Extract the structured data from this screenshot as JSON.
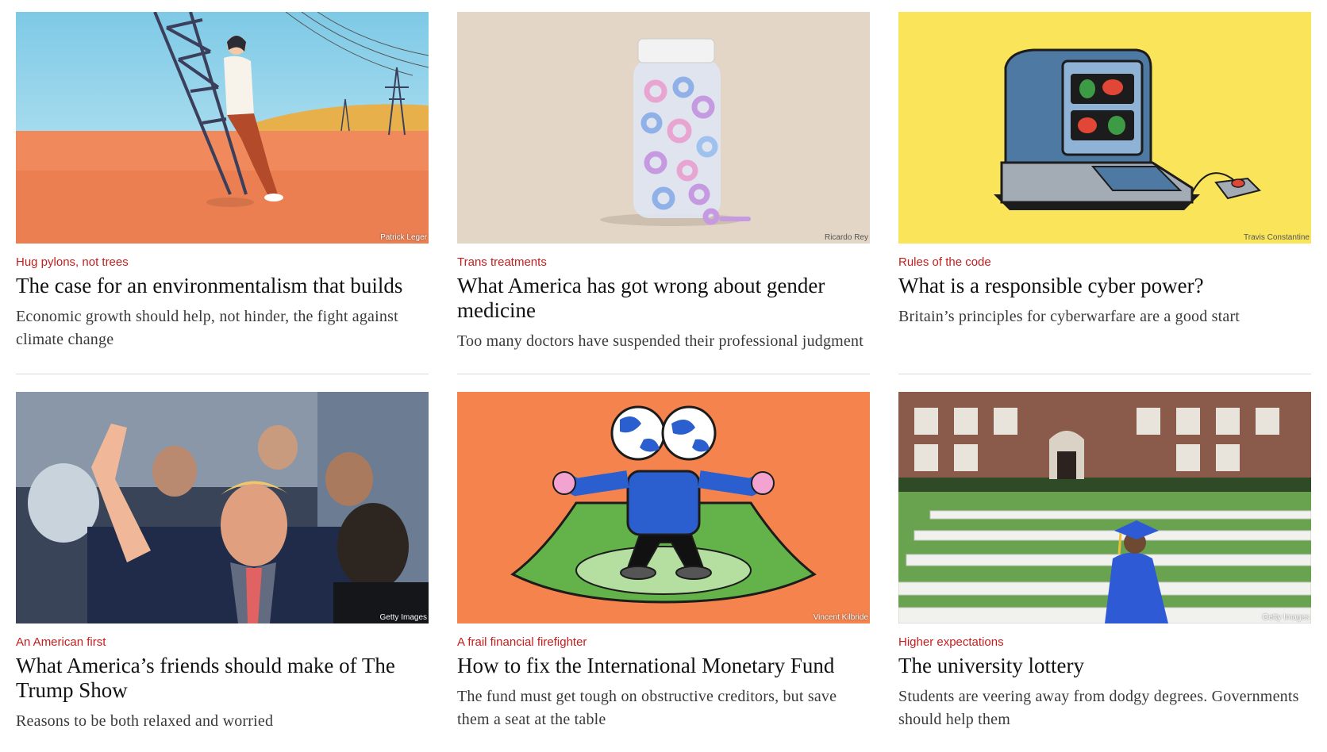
{
  "articles": [
    {
      "rubric": "Hug pylons, not trees",
      "headline": "The case for an environmentalism that builds",
      "description": "Economic growth should help, not hinder, the fight against climate change",
      "credit": "Patrick Leger",
      "image": "woman-hugging-pylon-illustration"
    },
    {
      "rubric": "Trans treatments",
      "headline": "What America has got wrong about gender medicine",
      "description": "Too many doctors have suspended their professional judgment",
      "credit": "Ricardo Rey",
      "image": "pill-bottle-gender-symbols-illustration"
    },
    {
      "rubric": "Rules of the code",
      "headline": "What is a responsible cyber power?",
      "description": "Britain’s principles for cyberwarfare are a good start",
      "credit": "Travis Constantine",
      "image": "retro-computer-illustration"
    },
    {
      "rubric": "An American first",
      "headline": "What America’s friends should make of The Trump Show",
      "description": "Reasons to be both relaxed and worried",
      "credit": "Getty Images",
      "image": "crowd-photo"
    },
    {
      "rubric": "A frail financial firefighter",
      "headline": "How to fix the International Monetary Fund",
      "description": "The fund must get tough on obstructive creditors, but save them a seat at the table",
      "credit": "Vincent Kilbride",
      "image": "globe-head-figure-banknote-illustration"
    },
    {
      "rubric": "Higher expectations",
      "headline": "The university lottery",
      "description": "Students are veering away from dodgy degrees. Governments should help them",
      "credit": "Getty Images",
      "image": "graduate-empty-chairs-photo"
    }
  ],
  "colors": {
    "rubric": "#c41e1e",
    "headline": "#121212",
    "description": "#3a3a3a",
    "divider": "#d9d9d9"
  }
}
